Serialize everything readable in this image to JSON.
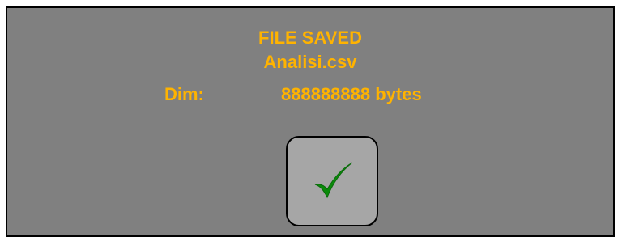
{
  "dialog": {
    "title": "FILE SAVED",
    "filename": "Analisi.csv",
    "size_label": "Dim:",
    "size_value": "888888888 bytes"
  },
  "ok_button": {
    "icon": "check-icon"
  },
  "colors": {
    "background": "#808080",
    "text": "#ffb300",
    "button_face": "#a6a6a6",
    "check": "#0a8a0a",
    "border": "#000000"
  }
}
